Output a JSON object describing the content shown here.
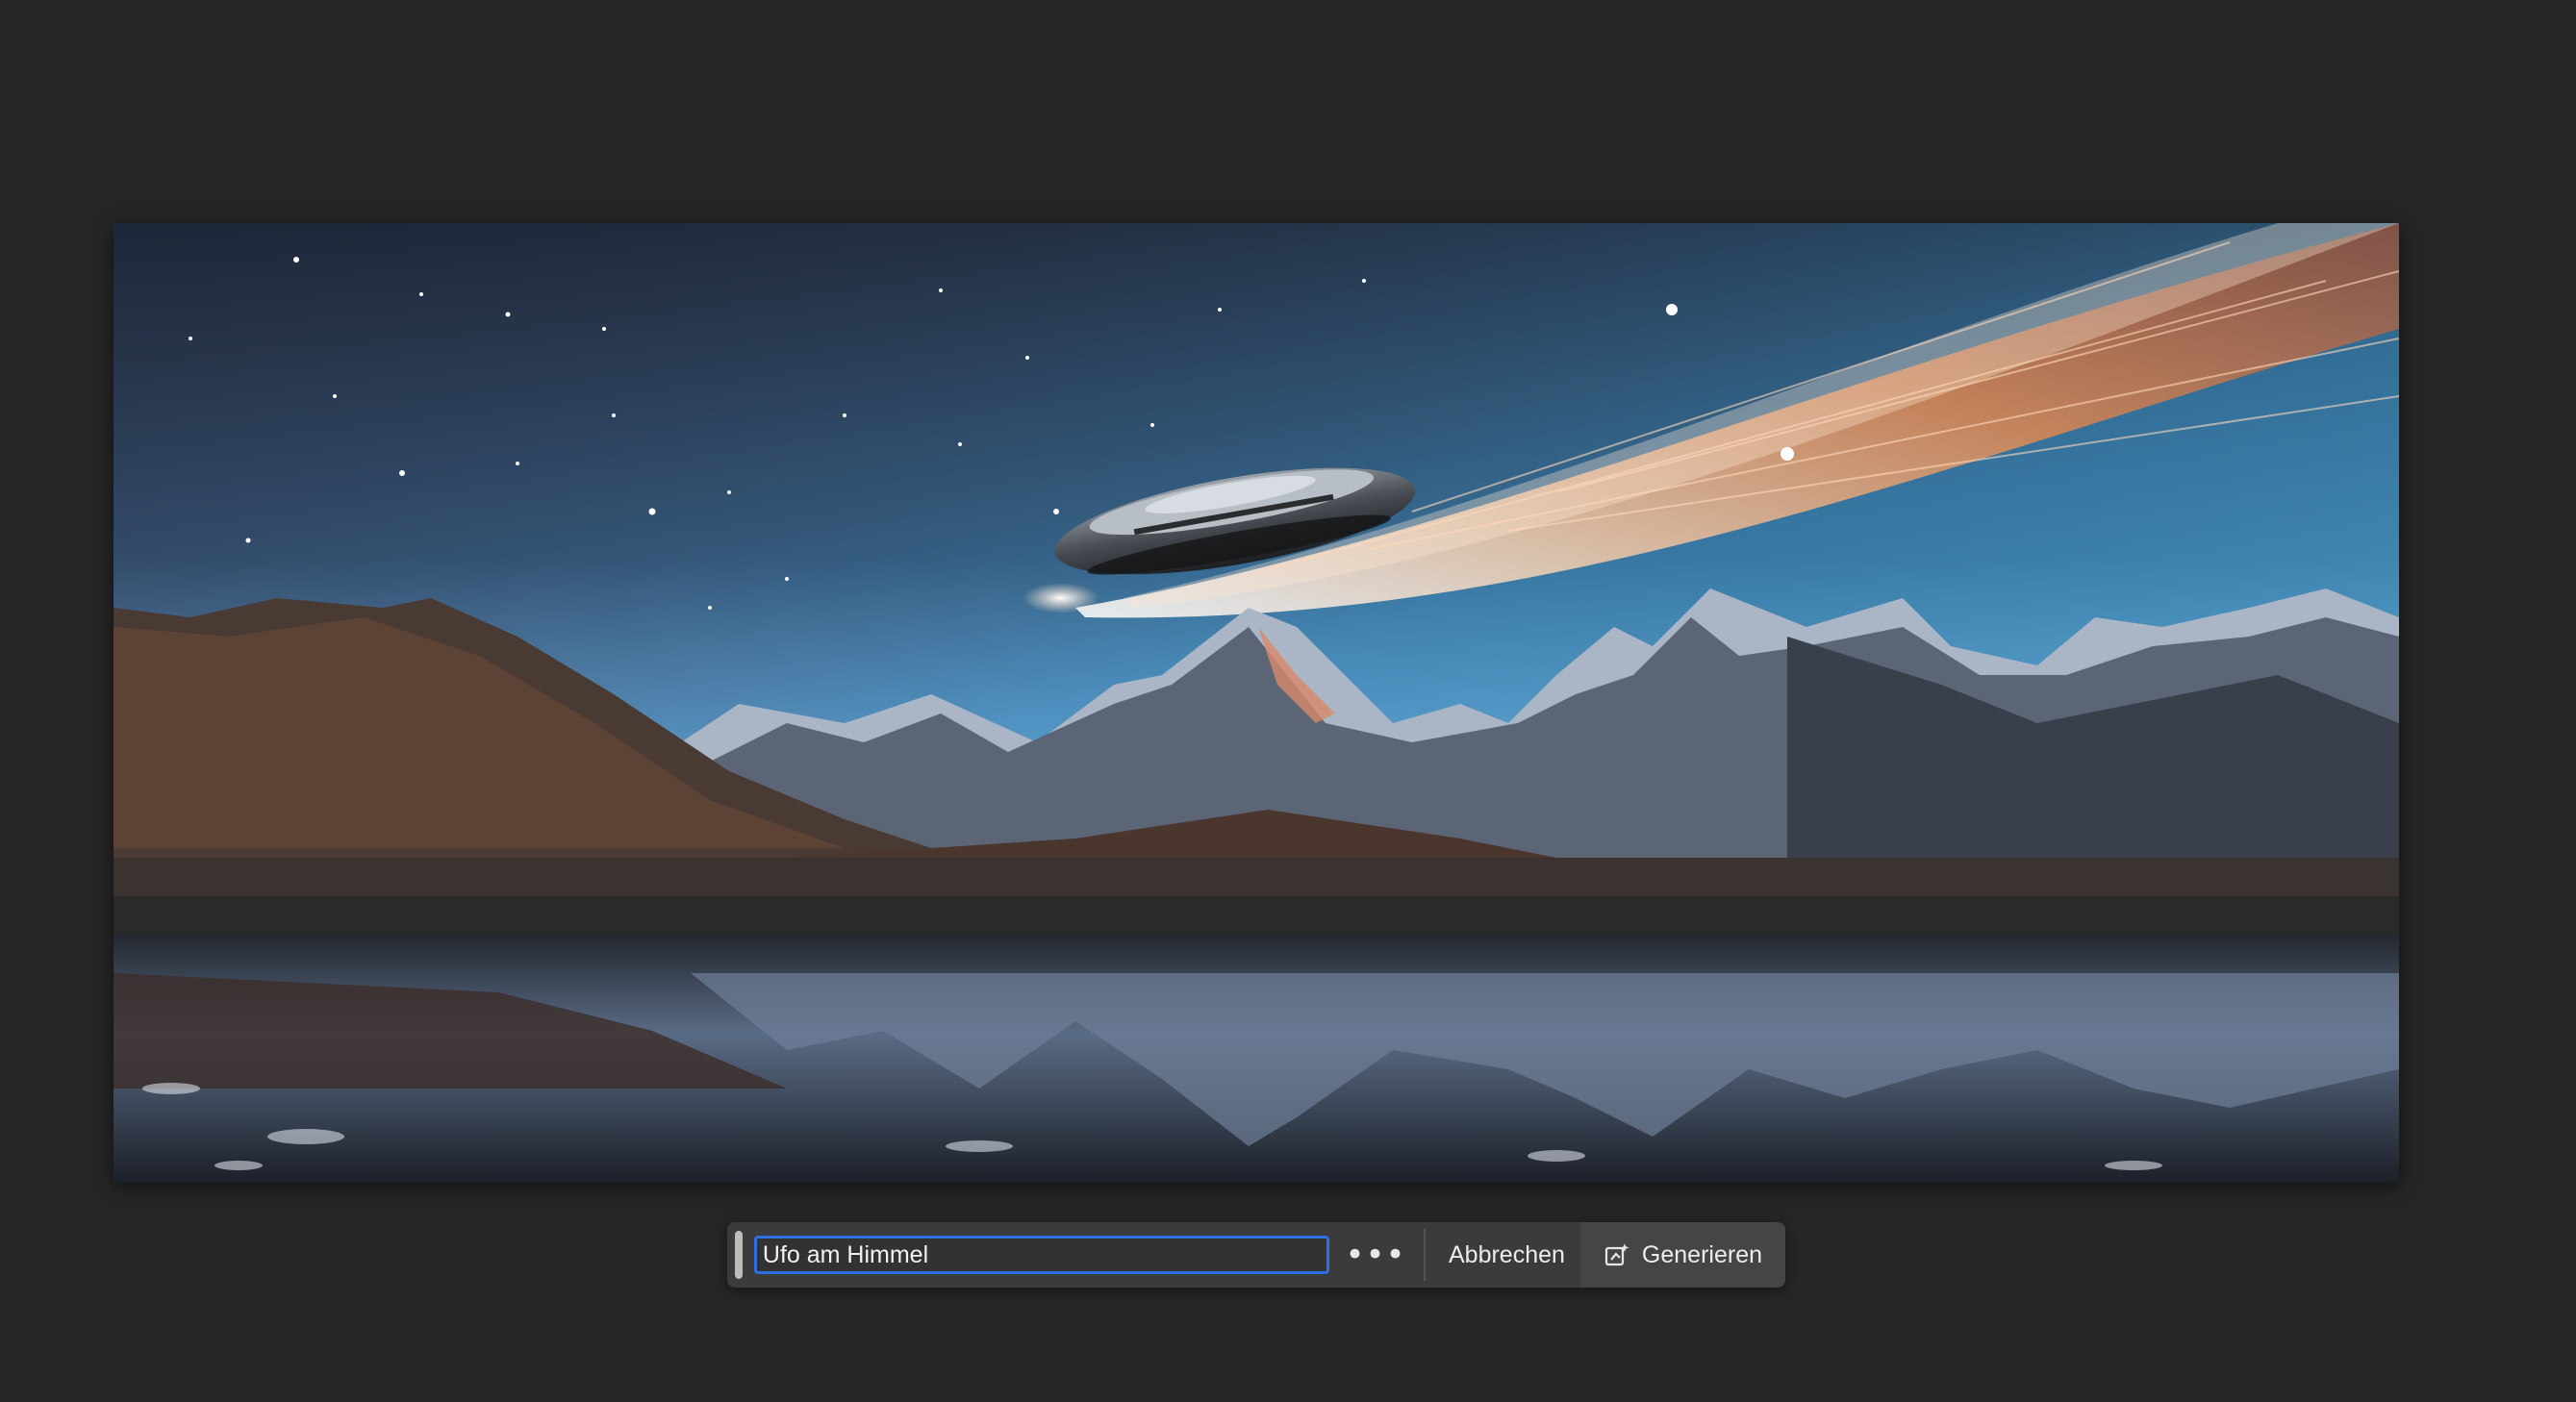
{
  "canvas": {
    "image_description_icon": "generated-image",
    "accent_color": "#2f6fe0",
    "background_color": "#262626"
  },
  "taskbar": {
    "prompt_value": "Ufo am Himmel",
    "more_icon": "ellipsis-icon",
    "more_label": "•••",
    "cancel_label": "Abbrechen",
    "generate_icon": "generate-sparkle-icon",
    "generate_label": "Generieren"
  }
}
